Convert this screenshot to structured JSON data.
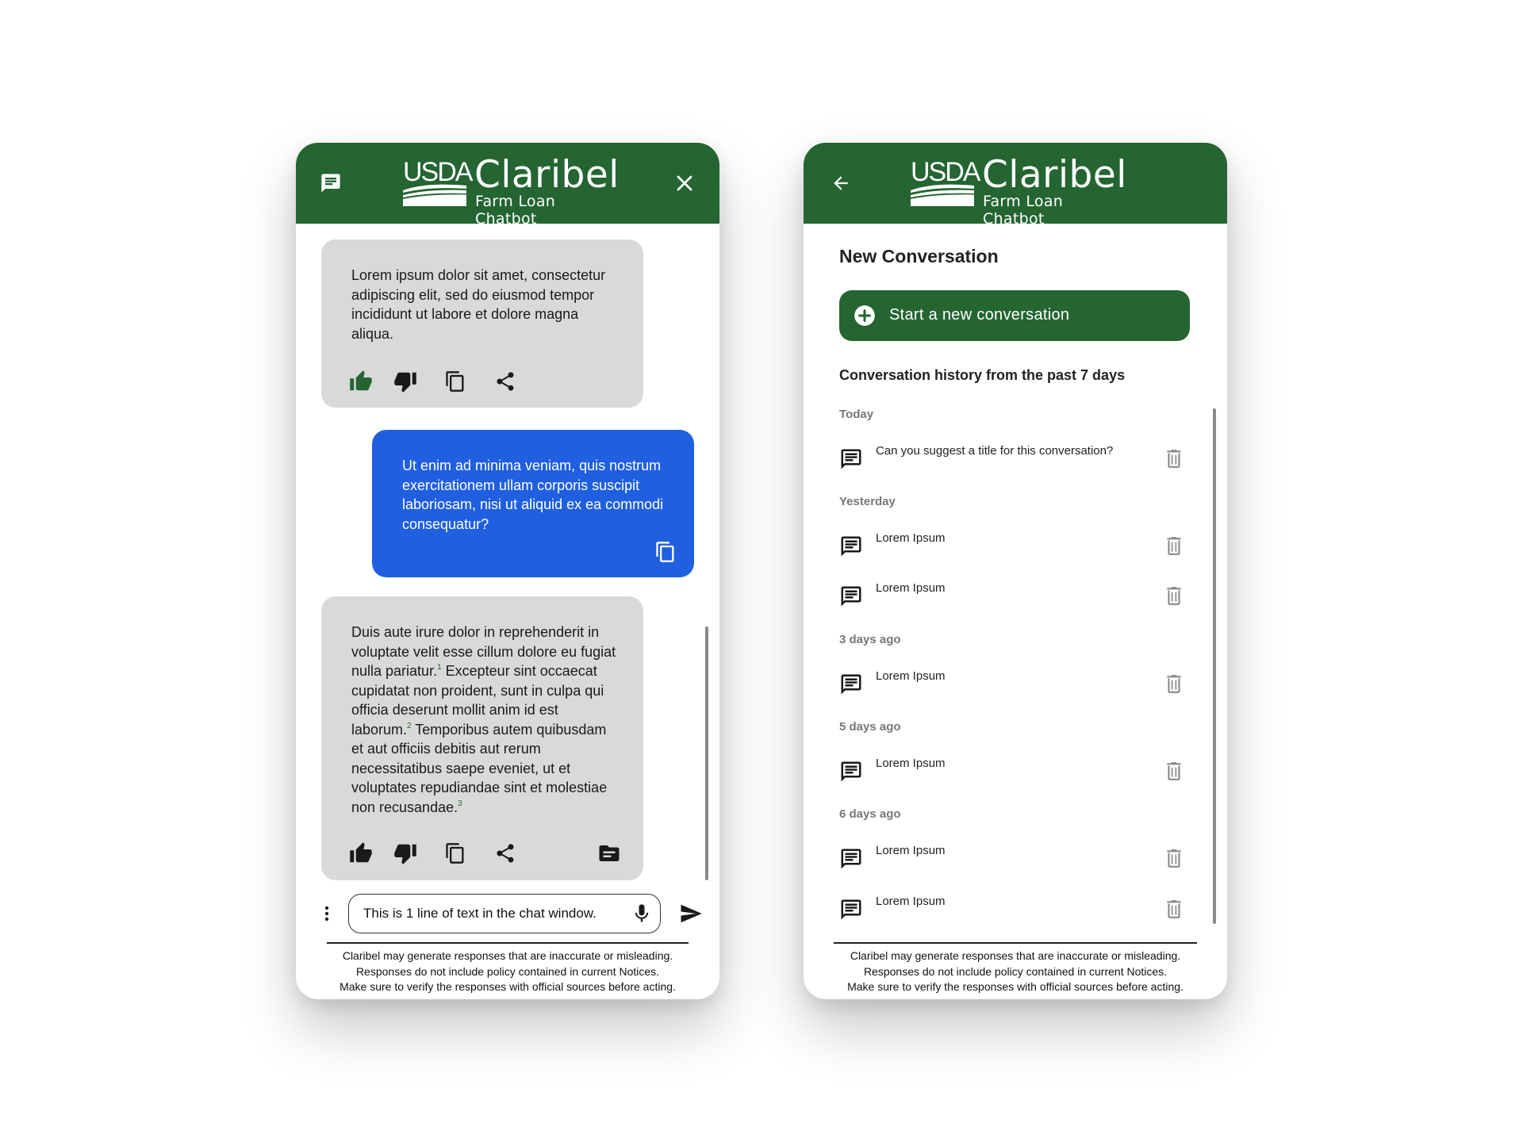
{
  "brand": {
    "logo_text": "USDA",
    "title": "Claribel",
    "subtitle": "Farm Loan Chatbot",
    "color": "#246532"
  },
  "chat_panel": {
    "header": {
      "left_icon": "chat-history-icon",
      "right_icon": "close-icon"
    },
    "messages": [
      {
        "role": "bot",
        "text": "Lorem ipsum dolor sit amet, consectetur adipiscing elit, sed do eiusmod tempor incididunt ut labore et dolore magna aliqua.",
        "actions": [
          "thumbs-up-icon (selected)",
          "thumbs-down-icon",
          "copy-icon",
          "share-icon"
        ]
      },
      {
        "role": "user",
        "text": "Ut enim ad minima veniam, quis nostrum exercitationem ullam corporis suscipit laboriosam, nisi ut aliquid ex ea commodi consequatur?",
        "actions": [
          "copy-icon"
        ]
      },
      {
        "role": "bot",
        "segments": [
          "Duis aute irure dolor in reprehenderit in voluptate velit esse cillum dolore eu fugiat nulla pariatur.",
          "1",
          " Excepteur sint occaecat cupidatat non proident, sunt in culpa qui officia deserunt mollit anim id est laborum.",
          "2",
          " Temporibus autem quibusdam et aut officiis debitis aut rerum necessitatibus saepe eveniet, ut et voluptates repudiandae sint et molestiae non recusandae.",
          "3"
        ],
        "actions": [
          "thumbs-up-icon",
          "thumbs-down-icon",
          "copy-icon",
          "share-icon",
          "sources-icon"
        ]
      }
    ],
    "input": {
      "value": "This is 1 line of text in the chat window.",
      "placeholder": ""
    },
    "disclaimer": [
      "Claribel may generate responses that are inaccurate or misleading.",
      "Responses do not include policy contained in current Notices.",
      "Make sure to verify the responses with official sources before acting."
    ]
  },
  "history_panel": {
    "header": {
      "left_icon": "back-arrow-icon"
    },
    "section_title": "New Conversation",
    "new_button_label": "Start a new conversation",
    "history_heading": "Conversation history from the past 7 days",
    "groups": [
      {
        "label": "Today",
        "items": [
          "Can you suggest a title for this conversation?"
        ]
      },
      {
        "label": "Yesterday",
        "items": [
          "Lorem Ipsum",
          "Lorem Ipsum"
        ]
      },
      {
        "label": "3 days ago",
        "items": [
          "Lorem Ipsum"
        ]
      },
      {
        "label": "5 days ago",
        "items": [
          "Lorem Ipsum"
        ]
      },
      {
        "label": "6 days ago",
        "items": [
          "Lorem Ipsum",
          "Lorem Ipsum"
        ]
      }
    ],
    "disclaimer": [
      "Claribel may generate responses that are inaccurate or misleading.",
      "Responses do not include policy contained in current Notices.",
      "Make sure to verify the responses with official sources before acting."
    ]
  },
  "colors": {
    "header_green": "#246532",
    "user_bubble": "#1f5fe0",
    "bot_bubble": "#d9d9d9",
    "liked": "#246532"
  }
}
